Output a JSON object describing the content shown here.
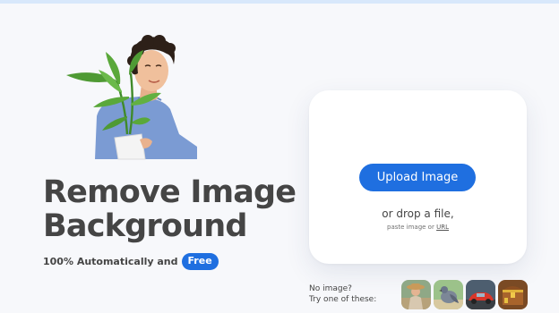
{
  "hero": {
    "title_line1": "Remove Image",
    "title_line2": "Background",
    "subtitle": "100% Automatically and",
    "badge": "Free",
    "image_label": "person-holding-plant-photo"
  },
  "upload_card": {
    "button_label": "Upload Image",
    "drop_text": "or drop a file,",
    "paste_prefix": "paste image or",
    "url_link": "URL"
  },
  "samples": {
    "line1": "No image?",
    "line2": "Try one of these:",
    "items": [
      "woman-with-hat",
      "pigeon",
      "red-car",
      "treasure-chest"
    ]
  },
  "colors": {
    "accent": "#1f6fe0",
    "background": "#f7f8fb",
    "text": "#454545"
  }
}
